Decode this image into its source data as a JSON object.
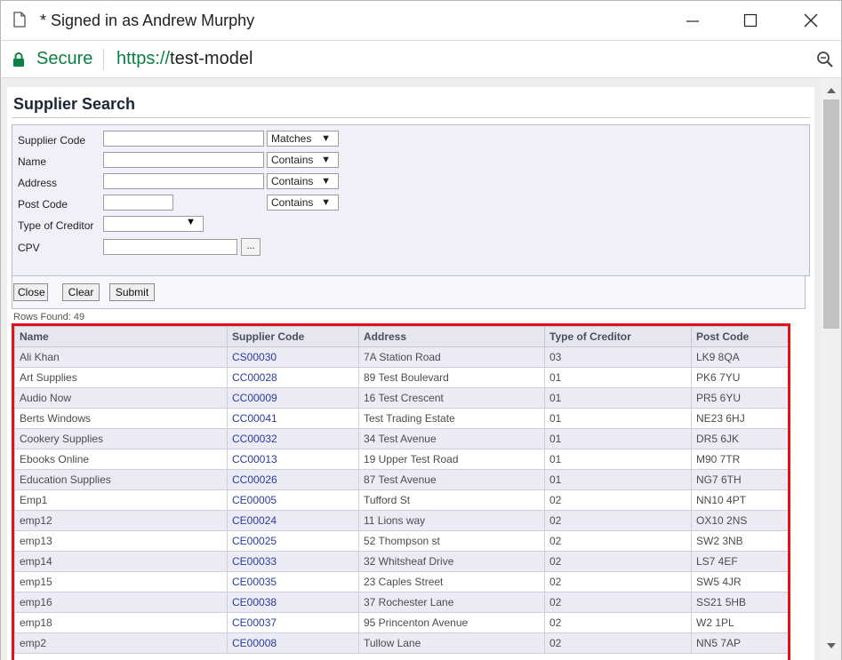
{
  "window": {
    "title": "* Signed in as Andrew Murphy"
  },
  "addressbar": {
    "secure_label": "Secure",
    "url_scheme": "https://",
    "url_host": "test-model"
  },
  "page": {
    "title": "Supplier Search"
  },
  "search": {
    "fields": {
      "supplier_code": {
        "label": "Supplier Code",
        "value": "",
        "operator": "Matches"
      },
      "name": {
        "label": "Name",
        "value": "",
        "operator": "Contains"
      },
      "address": {
        "label": "Address",
        "value": "",
        "operator": "Contains"
      },
      "post_code": {
        "label": "Post Code",
        "value": "",
        "operator": "Contains"
      },
      "type_of_creditor": {
        "label": "Type of Creditor",
        "value": ""
      },
      "cpv": {
        "label": "CPV",
        "value": "",
        "lookup_label": "..."
      }
    }
  },
  "buttons": {
    "close": "Close",
    "clear": "Clear",
    "submit": "Submit"
  },
  "results": {
    "rows_found": "Rows Found: 49",
    "columns": [
      "Name",
      "Supplier Code",
      "Address",
      "Type of Creditor",
      "Post Code"
    ],
    "rows": [
      [
        "Ali Khan",
        "CS00030",
        "7A Station Road",
        "03",
        "LK9 8QA"
      ],
      [
        "Art Supplies",
        "CC00028",
        "89 Test Boulevard",
        "01",
        "PK6 7YU"
      ],
      [
        "Audio Now",
        "CC00009",
        "16 Test Crescent",
        "01",
        "PR5 6YU"
      ],
      [
        "Berts Windows",
        "CC00041",
        "Test Trading Estate",
        "01",
        "NE23 6HJ"
      ],
      [
        "Cookery Supplies",
        "CC00032",
        "34 Test Avenue",
        "01",
        "DR5 6JK"
      ],
      [
        "Ebooks Online",
        "CC00013",
        "19 Upper Test Road",
        "01",
        "M90 7TR"
      ],
      [
        "Education Supplies",
        "CC00026",
        "87 Test Avenue",
        "01",
        "NG7 6TH"
      ],
      [
        "Emp1",
        "CE00005",
        "Tufford St",
        "02",
        "NN10 4PT"
      ],
      [
        "emp12",
        "CE00024",
        "11 Lions way",
        "02",
        "OX10 2NS"
      ],
      [
        "emp13",
        "CE00025",
        "52 Thompson st",
        "02",
        "SW2 3NB"
      ],
      [
        "emp14",
        "CE00033",
        "32 Whitsheaf Drive",
        "02",
        "LS7 4EF"
      ],
      [
        "emp15",
        "CE00035",
        "23 Caples Street",
        "02",
        "SW5 4JR"
      ],
      [
        "emp16",
        "CE00038",
        "37 Rochester Lane",
        "02",
        "SS21 5HB"
      ],
      [
        "emp18",
        "CE00037",
        "95 Princenton Avenue",
        "02",
        "W2 1PL"
      ],
      [
        "emp2",
        "CE00008",
        "Tullow Lane",
        "02",
        "NN5 7AP"
      ]
    ]
  },
  "colors": {
    "secure_green": "#0b8043",
    "highlight_red": "#e0121c",
    "link_blue": "#2a3c9e",
    "panel_bg": "#f0f0f8"
  },
  "icons": {
    "page": "page-icon",
    "lock": "lock-icon",
    "zoom": "zoom-icon",
    "minimize": "minimize-icon",
    "maximize": "maximize-icon",
    "close": "close-icon"
  }
}
